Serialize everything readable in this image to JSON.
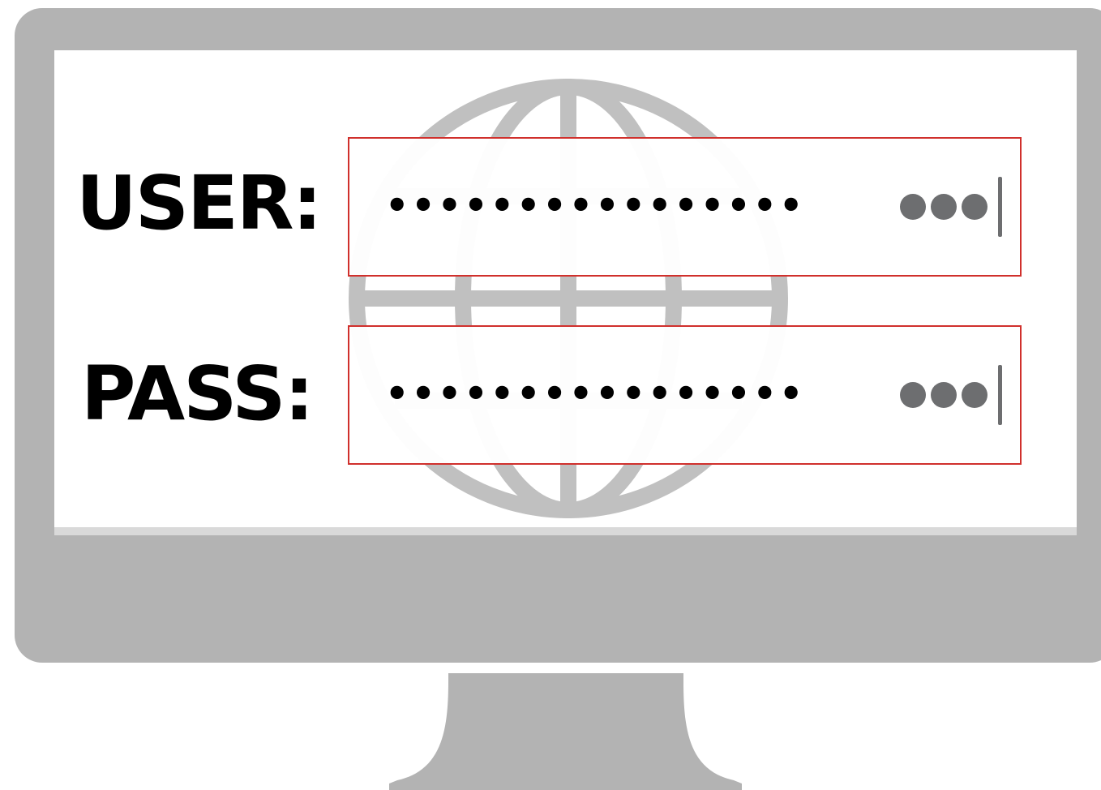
{
  "login_form": {
    "user_label": "USER:",
    "user_value_mask": "••••••••••••••••",
    "pass_label": "PASS:",
    "pass_value_mask": "••••••••••••••••"
  },
  "icons": {
    "background": "globe-icon",
    "more": "more-dots-icon",
    "caret": "text-caret-icon"
  },
  "colors": {
    "monitor": "#b3b3b3",
    "globe": "#c0c0c0",
    "field_border": "#d0302c",
    "dots": "#6d6e70",
    "text": "#000000"
  }
}
